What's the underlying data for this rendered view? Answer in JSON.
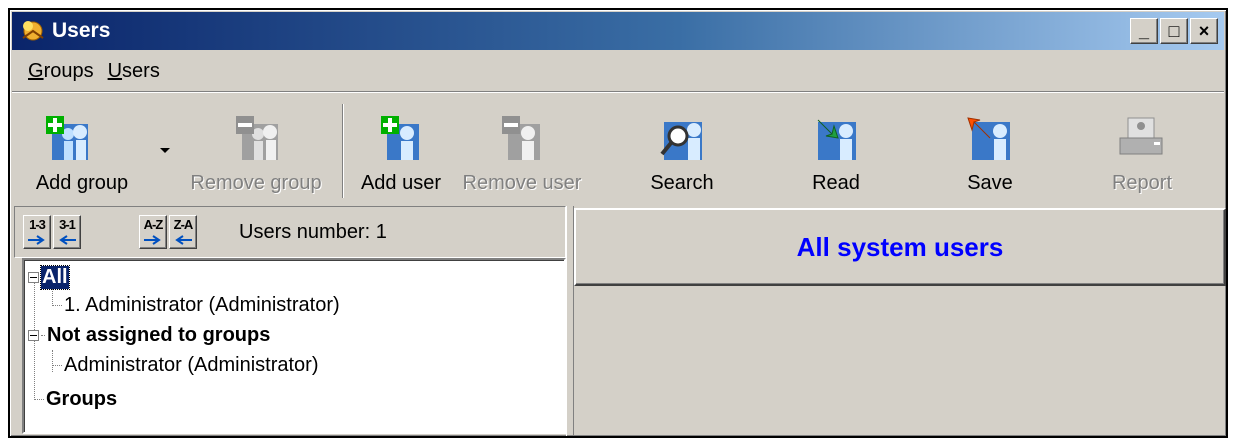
{
  "window": {
    "title": "Users"
  },
  "window_controls": {
    "minimize": "_",
    "maximize": "□",
    "close": "×"
  },
  "menu": [
    {
      "label_u": "G",
      "label_rest": "roups"
    },
    {
      "label_u": "U",
      "label_rest": "sers"
    }
  ],
  "toolbar": {
    "add_group": "Add group",
    "remove_group": "Remove group",
    "add_user": "Add user",
    "remove_user": "Remove user",
    "search": "Search",
    "read": "Read",
    "save": "Save",
    "report": "Report"
  },
  "sort_buttons": [
    {
      "text": "1-3"
    },
    {
      "text": "3-1"
    },
    {
      "text": "A-Z"
    },
    {
      "text": "Z-A"
    }
  ],
  "users_number": "Users number: 1",
  "tree": {
    "all": "All",
    "all_child": "1.  Administrator   (Administrator)",
    "not_assigned": "Not assigned to groups",
    "not_assigned_child": "Administrator   (Administrator)",
    "groups": "Groups"
  },
  "panel": {
    "title": "All system users"
  },
  "colors": {
    "title_blue": "#0000ff",
    "titlebar_start": "#0a246a",
    "face": "#d4d0c8"
  },
  "icons": [
    "users-app-icon",
    "add-group-icon",
    "remove-group-icon",
    "add-user-icon",
    "remove-user-icon",
    "search-icon",
    "read-icon",
    "save-icon",
    "report-icon"
  ]
}
